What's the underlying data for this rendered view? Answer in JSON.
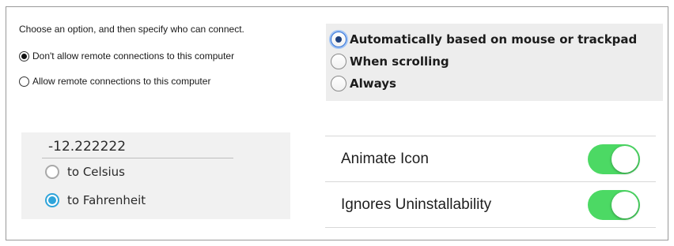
{
  "windows_remote": {
    "intro": "Choose an option, and then specify who can connect.",
    "options": [
      {
        "label": "Don't allow remote connections to this computer",
        "selected": true
      },
      {
        "label": "Allow remote connections to this computer",
        "selected": false
      }
    ]
  },
  "mac_radios": {
    "options": [
      {
        "label": "Automatically based on mouse or trackpad",
        "selected": true
      },
      {
        "label": "When scrolling",
        "selected": false
      },
      {
        "label": "Always",
        "selected": false
      }
    ]
  },
  "converter": {
    "value": "-12.222222",
    "options": [
      {
        "label": "to Celsius",
        "selected": false
      },
      {
        "label": "to Fahrenheit",
        "selected": true
      }
    ],
    "accent_color": "#2fa4da"
  },
  "ios_settings": {
    "rows": [
      {
        "label": "Animate Icon",
        "on": true
      },
      {
        "label": "Ignores Uninstallability",
        "on": true
      }
    ],
    "toggle_color": "#4cd964"
  }
}
